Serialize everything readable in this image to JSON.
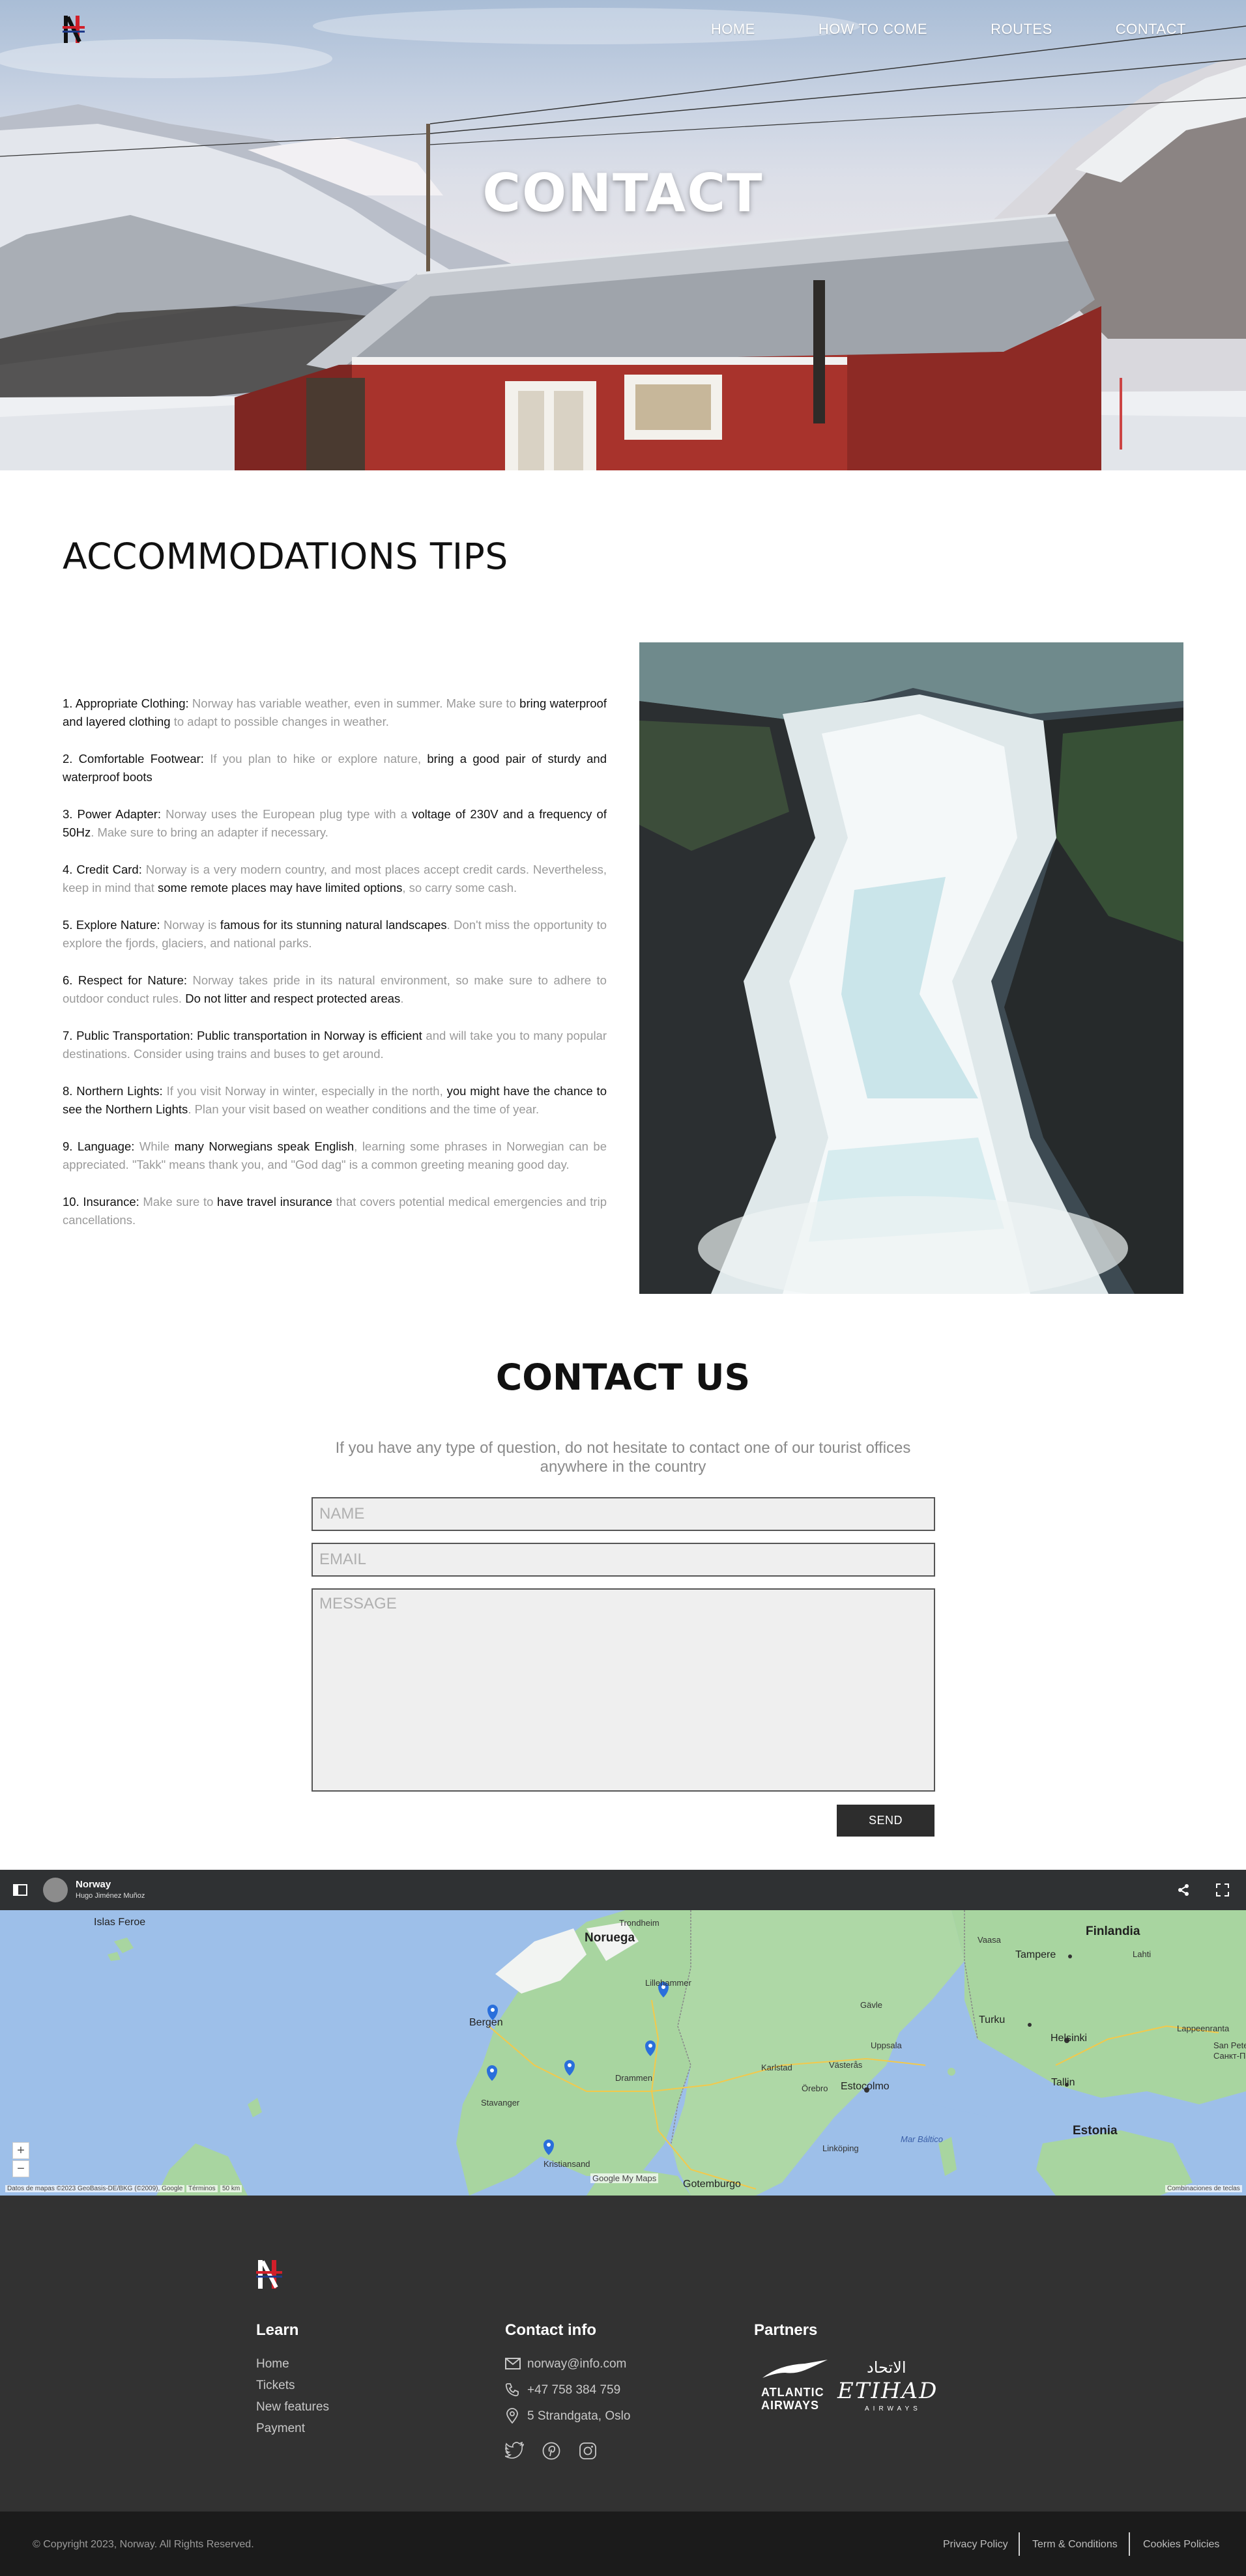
{
  "nav": {
    "items": [
      "HOME",
      "HOW TO COME",
      "ROUTES",
      "CONTACT"
    ]
  },
  "hero": {
    "title": "CONTACT"
  },
  "tips": {
    "heading": "ACCOMMODATIONS TIPS",
    "items": [
      {
        "label": "1. Appropriate Clothing:",
        "parts": [
          {
            "t": " Norway has variable weather, even in summer. Make sure to ",
            "h": false
          },
          {
            "t": "bring waterproof and layered clothing",
            "h": true
          },
          {
            "t": " to adapt to possible changes in weather.",
            "h": false
          }
        ]
      },
      {
        "label": "2. Comfortable Footwear:",
        "parts": [
          {
            "t": " If you plan to hike or explore nature, ",
            "h": false
          },
          {
            "t": "bring a good pair of sturdy and waterproof boots",
            "h": true
          }
        ]
      },
      {
        "label": "3. Power Adapter:",
        "parts": [
          {
            "t": " Norway uses the European plug type with a ",
            "h": false
          },
          {
            "t": "voltage of 230V and a frequency of 50Hz",
            "h": true
          },
          {
            "t": ". Make sure to bring an adapter if necessary.",
            "h": false
          }
        ]
      },
      {
        "label": "4. Credit Card:",
        "parts": [
          {
            "t": " Norway is a very modern country, and most places accept credit cards. Nevertheless, keep in mind that ",
            "h": false
          },
          {
            "t": "some remote places may have limited options",
            "h": true
          },
          {
            "t": ", so carry some cash.",
            "h": false
          }
        ]
      },
      {
        "label": "5. Explore Nature:",
        "parts": [
          {
            "t": " Norway is ",
            "h": false
          },
          {
            "t": "famous for its stunning natural landscapes",
            "h": true
          },
          {
            "t": ". Don't miss the opportunity to explore the fjords, glaciers, and national parks.",
            "h": false
          }
        ]
      },
      {
        "label": "6. Respect for Nature:",
        "parts": [
          {
            "t": " Norway takes pride in its natural environment, so make sure to adhere to outdoor conduct rules. ",
            "h": false
          },
          {
            "t": "Do not litter and respect protected areas",
            "h": true
          },
          {
            "t": ".",
            "h": false
          }
        ]
      },
      {
        "label": "7. Public Transportation:",
        "parts": [
          {
            "t": " Public transportation in Norway is efficient",
            "h": true
          },
          {
            "t": " and will take you to many popular destinations. Consider using trains and buses to get around.",
            "h": false
          }
        ]
      },
      {
        "label": "8. Northern Lights:",
        "parts": [
          {
            "t": " If you visit Norway in winter, especially in the north, ",
            "h": false
          },
          {
            "t": "you might have the chance to see the Northern Lights",
            "h": true
          },
          {
            "t": ". Plan your visit based on weather conditions and the time of year.",
            "h": false
          }
        ]
      },
      {
        "label": "9. Language:",
        "parts": [
          {
            "t": " While ",
            "h": false
          },
          {
            "t": "many Norwegians speak English",
            "h": true
          },
          {
            "t": ", learning some phrases in Norwegian can be appreciated. \"Takk\" means thank you, and \"God dag\" is a common greeting meaning good day.",
            "h": false
          }
        ]
      },
      {
        "label": "10. Insurance:",
        "parts": [
          {
            "t": " Make sure to ",
            "h": false
          },
          {
            "t": "have travel insurance",
            "h": true
          },
          {
            "t": " that covers potential medical emergencies and trip cancellations.",
            "h": false
          }
        ]
      }
    ]
  },
  "contact": {
    "title": "CONTACT US",
    "subtitle": "If you have any type of question, do not hesitate to contact one of our tourist offices anywhere in the country",
    "name_placeholder": "NAME",
    "email_placeholder": "EMAIL",
    "message_placeholder": "MESSAGE",
    "send_label": "SEND"
  },
  "map": {
    "title": "Norway",
    "author": "Hugo Jiménez Muñoz",
    "labels": {
      "islas_feroe": "Islas Feroe",
      "noruega": "Noruega",
      "finlandia": "Finlandia",
      "bergen": "Bergen",
      "estocolmo": "Estocolmo",
      "helsinki": "Helsinki",
      "tallin": "Tallin",
      "estonia": "Estonia",
      "gotemburgo": "Gotemburgo",
      "tampere": "Tampere",
      "turku": "Turku",
      "uppsala": "Uppsala",
      "san_petersburgo": "San Petersb",
      "san_petersburgo_cyr": "Санкт-Петер",
      "mar_baltico": "Mar Báltico",
      "stavanger": "Stavanger",
      "kristiansand": "Kristiansand",
      "drammen": "Drammen",
      "lillehammer": "Lillehammer",
      "vasteras": "Västerås",
      "orebro": "Örebro",
      "karlstad": "Karlstad",
      "gavle": "Gävle",
      "lahti": "Lahti",
      "vaasa": "Vaasa",
      "linkoping": "Linköping",
      "trondheim": "Trondheim",
      "lappeenranta": "Lappeenranta"
    },
    "attribution": "Datos de mapas ©2023 GeoBasis-DE/BKG (©2009), Google",
    "terms": "Términos",
    "scale": "50 km",
    "shortcuts": "Combinaciones de teclas",
    "mymaps": "Google My Maps"
  },
  "footer": {
    "learn_title": "Learn",
    "learn_links": [
      "Home",
      "Tickets",
      "New features",
      "Payment"
    ],
    "contact_title": "Contact info",
    "email": "norway@info.com",
    "phone": "+47 758 384 759",
    "address": "5 Strandgata, Oslo",
    "partners_title": "Partners",
    "partner_1_line1": "ATLANTIC",
    "partner_1_line2": "AIRWAYS",
    "partner_2_name": "ETIHAD",
    "partner_2_arabic": "الاتحاد",
    "partner_2_sub": "AIRWAYS",
    "copyright": "© Copyright 2023, Norway. All Rights Reserved.",
    "legal_links": [
      "Privacy Policy",
      "Term & Conditions",
      "Cookies Policies"
    ]
  },
  "colors": {
    "footer_bg": "#323232",
    "bottom_bar_bg": "#1b1b1b",
    "send_button_bg": "#2d2d2d",
    "logo_red": "#d11f2a",
    "map_water": "#9dbfe9",
    "map_land": "#a8d5a0"
  }
}
